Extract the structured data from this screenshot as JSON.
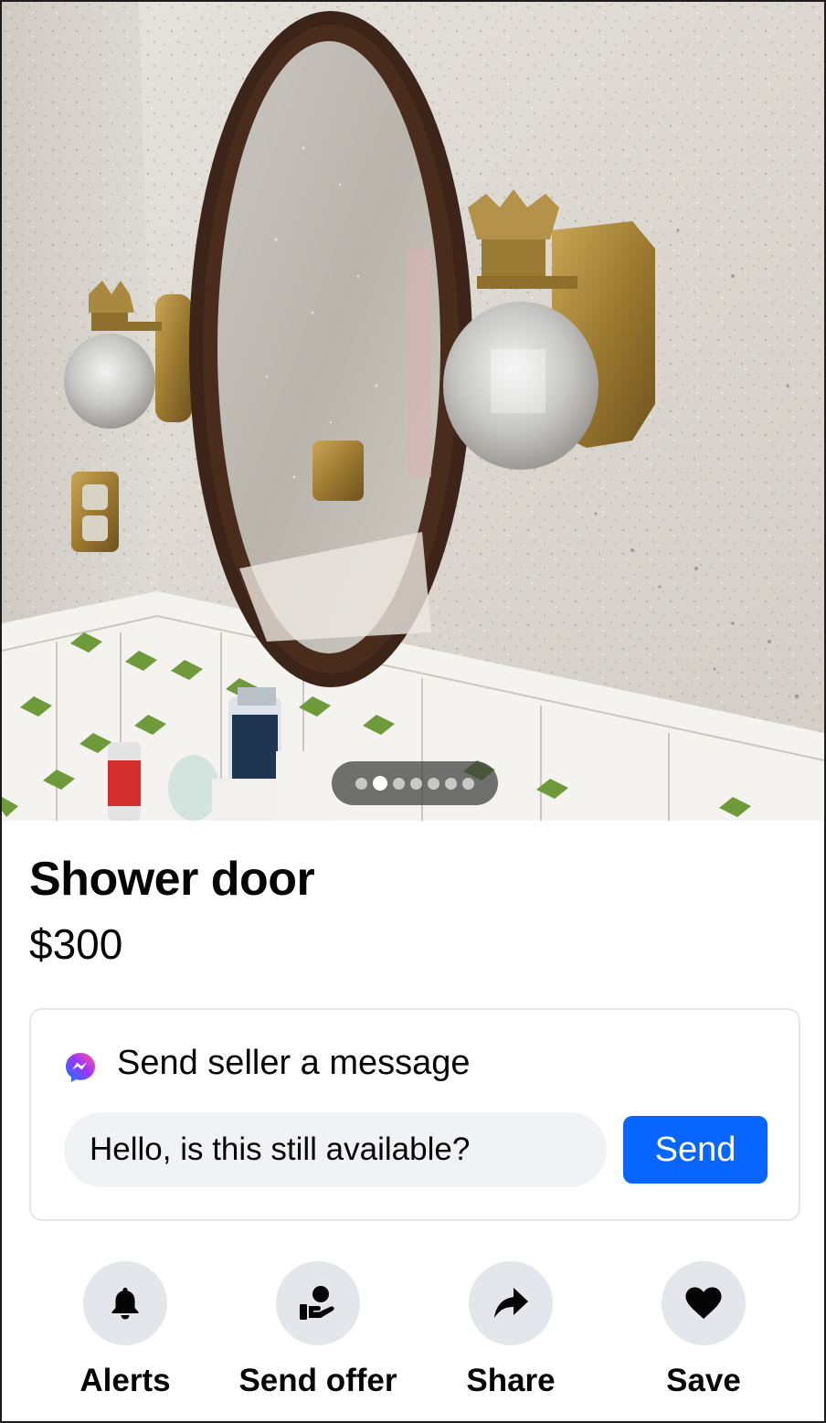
{
  "photo": {
    "description_icon": "bathroom-mirror-photo",
    "carousel": {
      "count": 7,
      "active_index": 1
    }
  },
  "listing": {
    "title": "Shower door",
    "price": "$300"
  },
  "message_card": {
    "icon": "messenger-icon",
    "heading": "Send seller a message",
    "input_value": "Hello, is this still available?",
    "send_label": "Send",
    "accent_color": "#0866ff"
  },
  "actions": [
    {
      "icon": "bell-icon",
      "label": "Alerts"
    },
    {
      "icon": "offer-icon",
      "label": "Send offer"
    },
    {
      "icon": "share-icon",
      "label": "Share"
    },
    {
      "icon": "heart-icon",
      "label": "Save"
    }
  ]
}
